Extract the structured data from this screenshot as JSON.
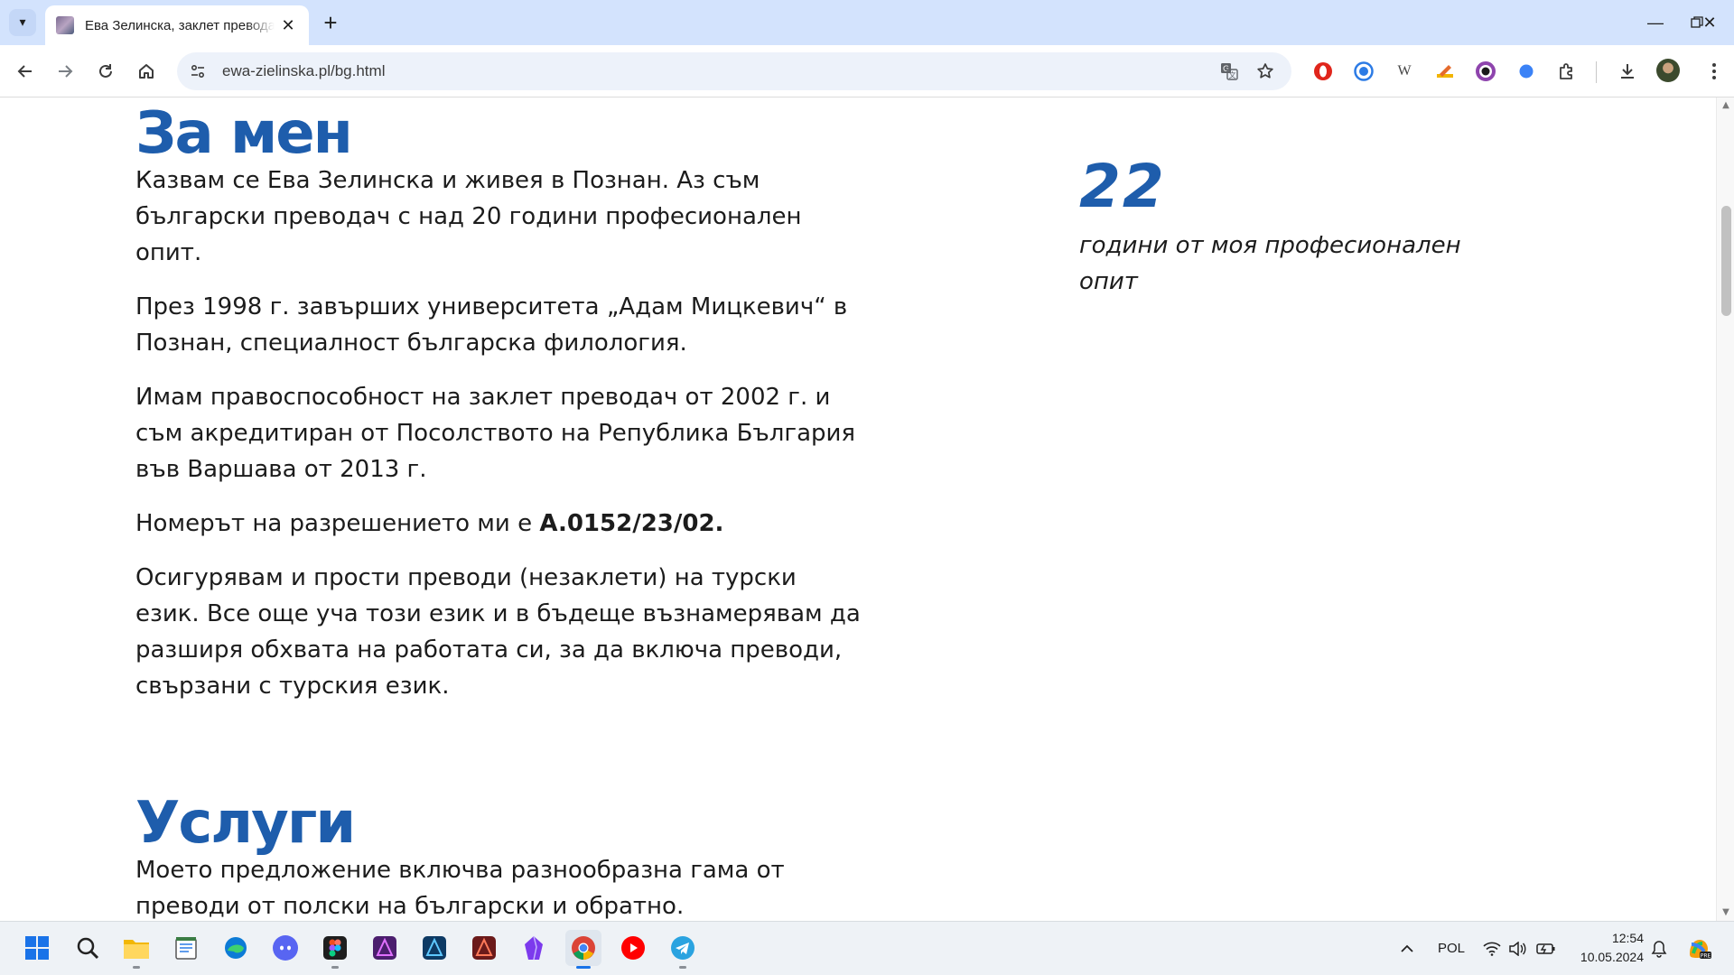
{
  "browser": {
    "tab": {
      "title": "Ева Зелинска, заклет преводач",
      "close_glyph": "✕"
    },
    "new_tab_glyph": "+",
    "url": "ewa-zielinska.pl/bg.html",
    "window_controls": {
      "minimize": "—",
      "restore": "❐",
      "close": "✕"
    },
    "icons": [
      "tab-list-icon",
      "back-icon",
      "forward-icon",
      "reload-icon",
      "home-icon",
      "site-info-icon",
      "translate-icon",
      "bookmark-star-icon",
      "extensions-icon",
      "download-icon",
      "menu-icon"
    ],
    "extension_glyphs": {
      "wikipedia": "W"
    }
  },
  "page": {
    "about": {
      "title": "За мен",
      "paragraphs": [
        "Казвам се Ева Зелинска и живея в Познан. Аз съм български преводач с над 20 години професионален опит.",
        "През 1998 г. завърших университета „Адам Мицкевич“ в Познан, специалност българска филология.",
        "Имам правоспособност на заклет преводач от 2002 г. и съм акредитиран от Посолството на Република България във Варшава от 2013 г."
      ],
      "permit_prefix": "Номерът на разрешението ми е ",
      "permit_number": "A.0152/23/02.",
      "turkish_paragraph": "Осигурявам и прости преводи (незаклети) на турски език. Все още уча този език и в бъдеще възнамерявам да разширя обхвата на работата си, за да включа преводи, свързани с турския език."
    },
    "stat": {
      "number": "22",
      "caption": "години от моя професионален опит"
    },
    "services": {
      "title": "Услуги",
      "paragraph": "Моето предложение включва разнообразна гама от преводи от полски на български и обратно. Допълнително мога да помогна като преводач при служебни въпроси: регистрация,"
    },
    "accent_color": "#1e5dac"
  },
  "taskbar": {
    "apps": [
      "start",
      "search",
      "file-explorer",
      "notepad",
      "edge",
      "discord",
      "figma",
      "affinity-photo",
      "affinity-designer",
      "affinity-publisher",
      "obsidian",
      "chrome",
      "youtube",
      "telegram"
    ],
    "language": "POL",
    "time": "12:54",
    "date": "10.05.2024"
  }
}
